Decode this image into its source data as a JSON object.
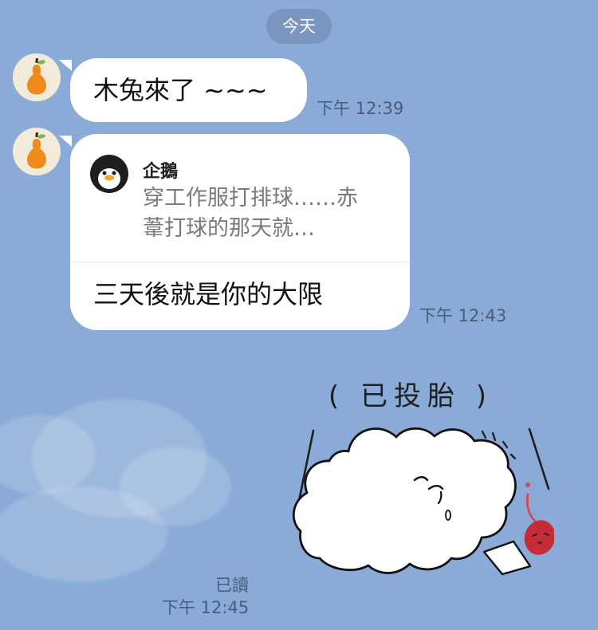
{
  "date_divider": "今天",
  "messages": [
    {
      "text": "木兔來了 ~~~",
      "time": "下午 12:39"
    },
    {
      "quote_name": "企鵝",
      "quote_preview_line1": "穿工作服打排球……赤",
      "quote_preview_line2": "葦打球的那天就…",
      "text": "三天後就是你的大限",
      "time": "下午 12:43"
    },
    {
      "sticker_text": "( 已投胎 )",
      "status": "已讀",
      "time": "下午 12:45"
    }
  ],
  "colors": {
    "background": "#8AABD8",
    "bubble": "#FFFFFF"
  },
  "icons": {
    "sender_avatar": "pear-icon",
    "quote_avatar": "penguin-icon"
  }
}
